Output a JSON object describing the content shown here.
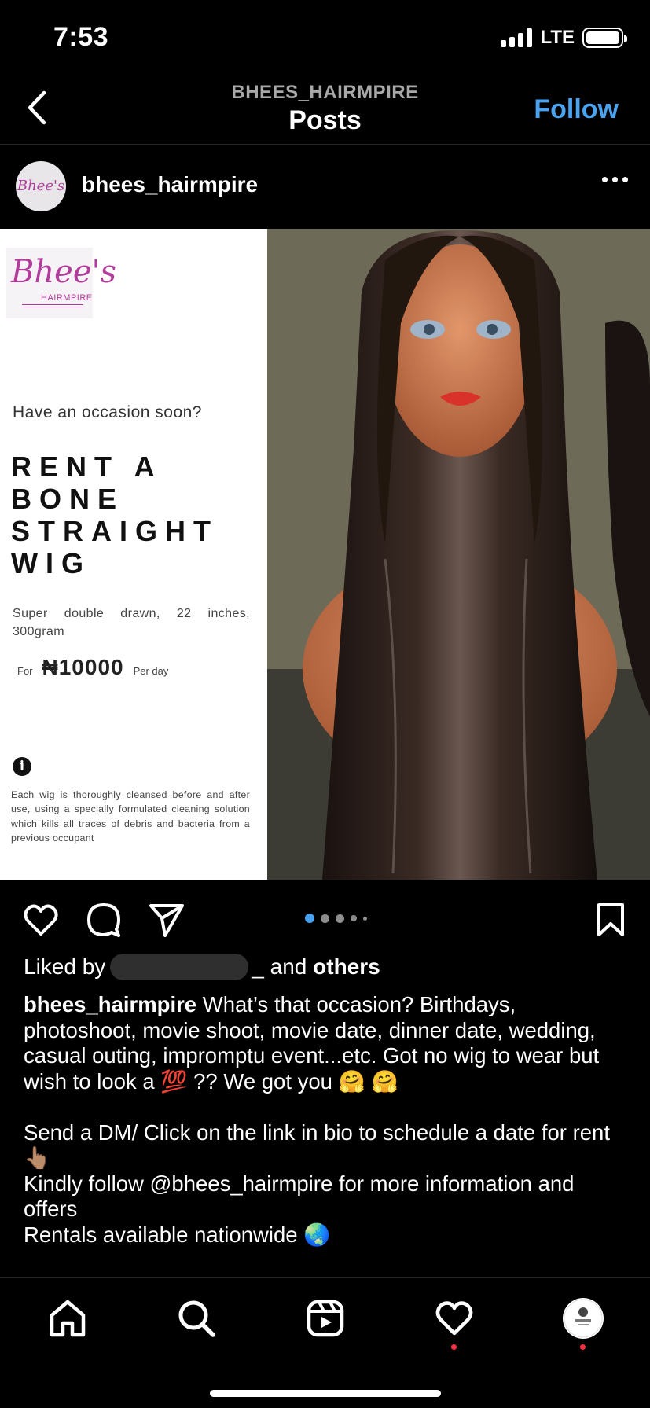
{
  "status_bar": {
    "time": "7:53",
    "network": "LTE"
  },
  "header": {
    "account": "BHEES_HAIRMPIRE",
    "title": "Posts",
    "follow_label": "Follow"
  },
  "post": {
    "username": "bhees_hairmpire",
    "media": {
      "brand": "Bhee's",
      "brand_sub": "HAIRMPIRE",
      "question": "Have an occasion soon?",
      "headline_lines": [
        "RENT A",
        "BONE",
        "STRAIGHT",
        "WIG"
      ],
      "specs": "Super double drawn, 22 inches, 300gram",
      "price_prefix": "For",
      "price": "₦10000",
      "price_suffix": "Per day",
      "disclaimer": "Each wig is thoroughly cleansed before and after use, using a specially formulated cleaning solution which kills all traces of debris and  bacteria from a previous occupant"
    },
    "carousel": {
      "total": 5,
      "active": 1
    },
    "likes": {
      "prefix": "Liked by",
      "middle": "_ and",
      "suffix": "others"
    },
    "caption": {
      "username": "bhees_hairmpire",
      "text": " What’s that occasion? Birthdays, photoshoot, movie shoot, movie date, dinner date, wedding, casual outing, impromptu event...etc. Got no wig to wear but wish to look a 💯 ?? We got you 🤗 🤗\n\nSend a DM/ Click on the link in bio to schedule a date for rent 👆🏽\nKindly follow @bhees_hairmpire for more information and offers\nRentals available nationwide 🌏"
    }
  },
  "colors": {
    "accent": "#4aa3f0",
    "brand": "#b23c9b",
    "notification": "#ff3040"
  },
  "tabs": [
    {
      "icon": "home-icon"
    },
    {
      "icon": "search-icon"
    },
    {
      "icon": "reels-icon"
    },
    {
      "icon": "heart-icon"
    },
    {
      "icon": "profile-avatar"
    }
  ]
}
